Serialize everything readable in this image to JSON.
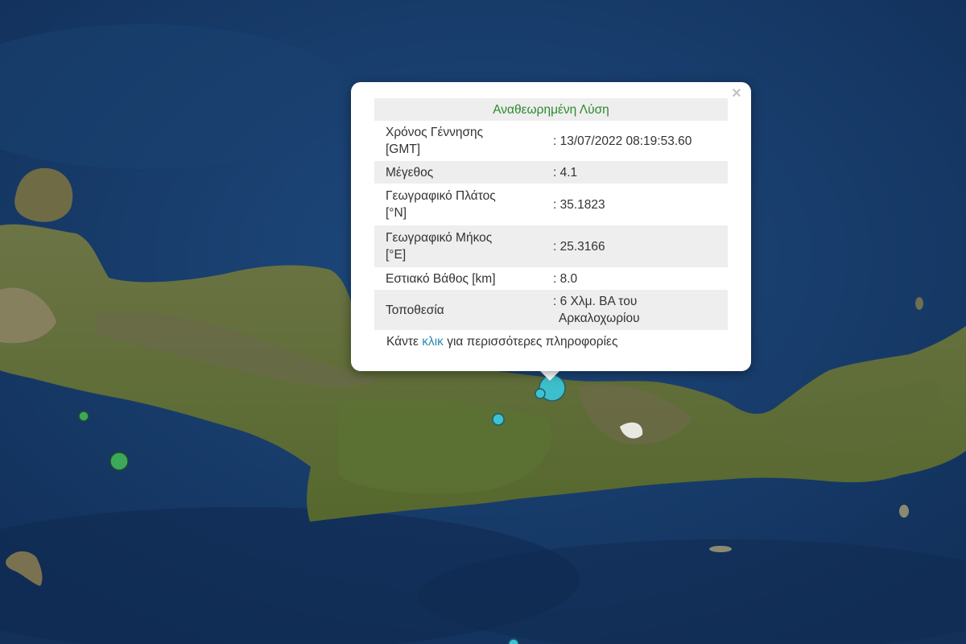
{
  "popup": {
    "title": "Αναθεωρημένη Λύση",
    "close_glyph": "×",
    "rows": [
      {
        "label_line1": "Χρόνος Γέννησης",
        "label_line2": "[GMT]",
        "value": ": 13/07/2022 08:19:53.60"
      },
      {
        "label_line1": "Μέγεθος",
        "label_line2": "",
        "value": ": 4.1"
      },
      {
        "label_line1": "Γεωγραφικό Πλάτος",
        "label_line2": "[°N]",
        "value": ": 35.1823"
      },
      {
        "label_line1": "Γεωγραφικό Μήκος",
        "label_line2": "[°E]",
        "value": ": 25.3166"
      },
      {
        "label_line1": "Εστιακό Βάθος [km]",
        "label_line2": "",
        "value": ": 8.0"
      },
      {
        "label_line1": "Τοποθεσία",
        "label_line2": "",
        "value_line1": ": 6 Χλμ. ΒΑ του",
        "value_line2": "Αρκαλοχωρίου"
      }
    ],
    "more_prefix": "Κάντε ",
    "more_link": "κλικ",
    "more_suffix": " για περισσότερες πληροφορίες"
  },
  "colors": {
    "sea": "#163866",
    "land": "#5a6d35",
    "title_green": "#2c8a2c",
    "link_blue": "#2a8ab4",
    "marker_cyan": "#3cc3d3",
    "marker_green": "#3ea85a"
  },
  "markers": [
    {
      "kind": "main-event",
      "color": "cyan"
    },
    {
      "kind": "event",
      "color": "cyan"
    },
    {
      "kind": "event",
      "color": "cyan"
    },
    {
      "kind": "event",
      "color": "cyan"
    },
    {
      "kind": "event",
      "color": "green"
    },
    {
      "kind": "event",
      "color": "green"
    }
  ]
}
